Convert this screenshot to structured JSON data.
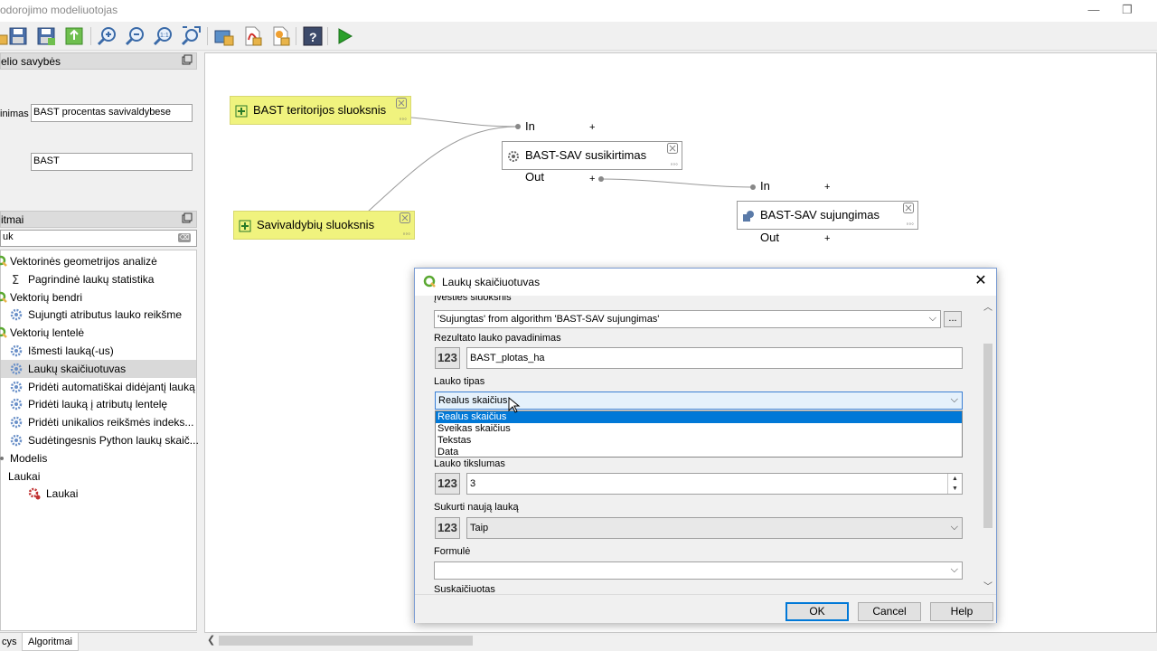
{
  "window": {
    "title": "odorojimo modeliuotojas",
    "minimize": "—",
    "restore": "❐"
  },
  "toolbar": {
    "buttons": [
      "open-icon",
      "save-icon",
      "save-as-icon",
      "export-icon",
      "zoom-in-icon",
      "zoom-out-icon",
      "zoom-actual-icon",
      "zoom-full-icon",
      "export-image-icon",
      "export-pdf-icon",
      "export-svg-icon",
      "help-icon",
      "run-icon"
    ],
    "zoom_actual_label": "1:1",
    "help_label": "?"
  },
  "properties_panel": {
    "title": "elio savybės",
    "name_label": "inimas",
    "name_value": "BAST procentas savivaldybese",
    "group_value": "BAST"
  },
  "algorithms_panel": {
    "title": "itmai",
    "search_value": "uk",
    "tree": [
      {
        "label": "Vektorinės geometrijos analizė",
        "icon": "qgis-icon",
        "indent": 0
      },
      {
        "label": "Pagrindinė laukų statistika",
        "icon": "sigma-icon",
        "indent": 1
      },
      {
        "label": "Vektorių bendri",
        "icon": "qgis-icon",
        "indent": 0
      },
      {
        "label": "Sujungti atributus lauko reikšme",
        "icon": "gear-icon",
        "indent": 1
      },
      {
        "label": "Vektorių lentelė",
        "icon": "qgis-icon",
        "indent": 0
      },
      {
        "label": "Išmesti lauką(-us)",
        "icon": "gear-icon",
        "indent": 1
      },
      {
        "label": "Laukų skaičiuotuvas",
        "icon": "gear-icon",
        "indent": 1,
        "selected": true
      },
      {
        "label": "Pridėti automatiškai didėjantį lauką",
        "icon": "gear-icon",
        "indent": 1
      },
      {
        "label": "Pridėti lauką į atributų lentelę",
        "icon": "gear-icon",
        "indent": 1
      },
      {
        "label": "Pridėti unikalios reikšmės indeks...",
        "icon": "gear-icon",
        "indent": 1
      },
      {
        "label": "Sudėtingesnis Python laukų skaič...",
        "icon": "gear-icon",
        "indent": 1
      },
      {
        "label": "Modelis",
        "icon": "expand-icon",
        "indent": 0
      },
      {
        "label": "Laukai",
        "icon": "none",
        "indent": 0
      },
      {
        "label": "Laukai",
        "icon": "model-gear-icon",
        "indent": 2
      }
    ],
    "tabs": [
      "cys",
      "Algoritmai"
    ]
  },
  "canvas": {
    "nodes": {
      "input1": "BAST teritorijos sluoksnis",
      "input2": "Savivaldybių sluoksnis",
      "alg1": "BAST-SAV susikirtimas",
      "alg2": "BAST-SAV sujungimas"
    },
    "port_in": "In",
    "port_out": "Out",
    "plus": "+",
    "dots": "◦◦◦",
    "close": "✕"
  },
  "dialog": {
    "title": "Laukų skaičiuotuvas",
    "close": "✕",
    "input_layer_label": "Įvesties sluoksnis",
    "input_layer_value": "'Sujungtas' from algorithm 'BAST-SAV sujungimas'",
    "dots_button": "...",
    "result_field_label": "Rezultato lauko pavadinimas",
    "result_field_value": "BAST_plotas_ha",
    "field_type_label": "Lauko tipas",
    "field_type_value": "Realus skaičius",
    "field_type_options": [
      "Realus skaičius",
      "Sveikas skaičius",
      "Tekstas",
      "Data"
    ],
    "precision_label": "Lauko tikslumas",
    "precision_value": "3",
    "create_new_label": "Sukurti naują lauką",
    "create_new_value": "Taip",
    "formula_label": "Formulė",
    "formula_value": "",
    "calculated_label": "Suskaičiuotas",
    "num_icon": "123",
    "ok": "OK",
    "cancel": "Cancel",
    "help": "Help"
  }
}
